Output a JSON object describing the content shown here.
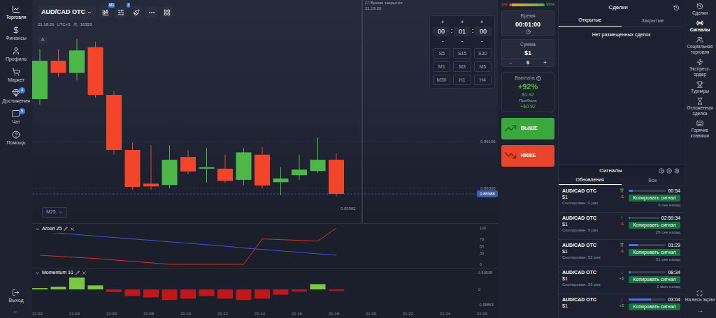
{
  "sidebar": {
    "items": [
      {
        "label": "Торговля",
        "selected": true
      },
      {
        "label": "Финансы",
        "selected": false
      },
      {
        "label": "Профиль",
        "selected": false
      },
      {
        "label": "Маркет",
        "selected": false
      },
      {
        "label": "Достижения",
        "selected": false,
        "badge": "4"
      },
      {
        "label": "Чат",
        "selected": false,
        "badge": "5"
      },
      {
        "label": "Помощь",
        "selected": false
      }
    ],
    "exit": "Выход",
    "collapse": "←"
  },
  "chart": {
    "asset": "AUD/CAD OTC",
    "toolbar_badges": [
      "M1",
      "3"
    ],
    "clock": "21:18:26",
    "timezone": "UTC+5",
    "online": "16328",
    "label_a": "A",
    "timeframe": "M25",
    "close_time": {
      "label": "Время закрытия",
      "value": "21:19:26"
    },
    "price_ticks": [
      {
        "value": 0.861,
        "label": "0.86100"
      },
      {
        "value": 0.86,
        "label": "0.86000"
      }
    ],
    "current_price": {
      "value": 0.85988,
      "label": "0.85988"
    },
    "low_label": "0.85982",
    "candles": [
      {
        "open": 0.86191,
        "close": 0.86273,
        "high": 0.86298,
        "low": 0.86179
      },
      {
        "open": 0.86273,
        "close": 0.86247,
        "high": 0.86298,
        "low": 0.86238
      },
      {
        "open": 0.86247,
        "close": 0.86295,
        "high": 0.8632,
        "low": 0.86231
      },
      {
        "open": 0.86302,
        "close": 0.862,
        "high": 0.86313,
        "low": 0.86194
      },
      {
        "open": 0.862,
        "close": 0.86082,
        "high": 0.86209,
        "low": 0.86072
      },
      {
        "open": 0.86082,
        "close": 0.86003,
        "high": 0.86097,
        "low": 0.85997
      },
      {
        "open": 0.8601,
        "close": 0.86004,
        "high": 0.86092,
        "low": 0.85997
      },
      {
        "open": 0.86007,
        "close": 0.86061,
        "high": 0.86092,
        "low": 0.86
      },
      {
        "open": 0.86067,
        "close": 0.86036,
        "high": 0.86082,
        "low": 0.8603
      },
      {
        "open": 0.86042,
        "close": 0.86045,
        "high": 0.86086,
        "low": 0.86012
      },
      {
        "open": 0.86042,
        "close": 0.86016,
        "high": 0.86072,
        "low": 0.86012
      },
      {
        "open": 0.86018,
        "close": 0.86077,
        "high": 0.86086,
        "low": 0.86007
      },
      {
        "open": 0.86072,
        "close": 0.86006,
        "high": 0.86089,
        "low": 0.86
      },
      {
        "open": 0.86013,
        "close": 0.86021,
        "high": 0.86045,
        "low": 0.85985
      },
      {
        "open": 0.86028,
        "close": 0.8604,
        "high": 0.86072,
        "low": 0.86018
      },
      {
        "open": 0.86037,
        "close": 0.86061,
        "high": 0.86109,
        "low": 0.86033
      },
      {
        "open": 0.86061,
        "close": 0.85988,
        "high": 0.86075,
        "low": 0.85982
      }
    ],
    "x_labels": [
      "21:02",
      "21:04",
      "21:06",
      "21:08",
      "21:10",
      "21:12",
      "21:14",
      "21:16",
      "21:18",
      "21:20",
      "21:22",
      "21:24",
      "21:26"
    ],
    "aroon": {
      "title": "Aroon 25",
      "ticks": [
        "100",
        "70",
        "50",
        "30",
        "0"
      ],
      "up": [
        25,
        22,
        19,
        16,
        12,
        8,
        4,
        0,
        0,
        0,
        0,
        0,
        70,
        68,
        66,
        64,
        100
      ],
      "down": [
        90,
        86,
        82,
        78,
        74,
        70,
        66,
        62,
        58,
        54,
        50,
        45,
        41,
        37,
        33,
        29,
        25
      ]
    },
    "momentum": {
      "title": "Momentum 10",
      "ticks": [
        {
          "value": 0.63538,
          "label": "0.63538"
        },
        {
          "value": 0,
          "label": "0"
        },
        {
          "value": -0.58863,
          "label": "-0.58863"
        }
      ],
      "values": [
        0.05,
        0.1,
        0.45,
        0.15,
        -0.1,
        -0.25,
        -0.3,
        -0.4,
        -0.35,
        -0.25,
        -0.35,
        -0.4,
        -0.35,
        -0.2,
        -0.08,
        0.2,
        -0.05
      ]
    }
  },
  "time_picker": {
    "plus": [
      "+",
      "+",
      "+"
    ],
    "values": [
      "00",
      "01",
      "00"
    ],
    "separator": ":",
    "minus": [
      "-",
      "-",
      "-"
    ],
    "presets": [
      {
        "label": "S5",
        "selected": false
      },
      {
        "label": "S15",
        "selected": false
      },
      {
        "label": "S30",
        "selected": false
      },
      {
        "label": "M1",
        "selected": false
      },
      {
        "label": "M3",
        "selected": false
      },
      {
        "label": "M5",
        "selected": false
      },
      {
        "label": "M30",
        "selected": false
      },
      {
        "label": "H1",
        "selected": false
      },
      {
        "label": "H4",
        "selected": false
      }
    ]
  },
  "trade": {
    "sentiment": {
      "down": "1%",
      "up": "99%",
      "level": 0.99
    },
    "time_label": "Время",
    "time_value": "00:01:00",
    "amount_label": "Сумма",
    "amount_value": "$1",
    "amount_buttons": [
      "-",
      "$",
      "+"
    ],
    "payout_label": "Выплата",
    "payout_help": "?",
    "payout_percent": "+92%",
    "payout_amount": "$1.92",
    "profit_label": "Прибыль",
    "profit_value": "+$0.92",
    "up_button": "ВЫШЕ",
    "down_button": "НИЖЕ"
  },
  "deals": {
    "title": "Сделки",
    "tabs": [
      {
        "label": "Открытые",
        "selected": true
      },
      {
        "label": "Закрытые",
        "selected": false
      }
    ],
    "empty": "Нет размещенных сделок"
  },
  "signals": {
    "title": "Сигналы",
    "tabs": [
      {
        "label": "Обновления",
        "selected": true
      },
      {
        "label": "Все",
        "selected": false
      }
    ],
    "rows": [
      {
        "pair": "AUD/CAD OTC",
        "amount": "$1",
        "arrow": "⇈",
        "direction": "up",
        "result": "-$",
        "result_positive": false,
        "time": "00:54",
        "level": 0.12,
        "button": "Копировать сигнал",
        "copied": "Скопирован: 0 раз",
        "ago": "6 сек назад"
      },
      {
        "pair": "AUD/CAD OTC",
        "amount": "$1",
        "arrow": "↑",
        "direction": "up",
        "result": "-$",
        "result_positive": false,
        "time": "02:59:34",
        "level": 0.05,
        "button": "Копировать сигнал",
        "copied": "Скопирован: 9 раз",
        "ago": "26 сек назад"
      },
      {
        "pair": "AUD/CAD OTC",
        "amount": "$1",
        "arrow": "⇈",
        "direction": "up",
        "result": "-$",
        "result_positive": false,
        "time": "01:29",
        "level": 0.25,
        "button": "Копировать сигнал",
        "copied": "Скопирован: 52 раз",
        "ago": "31 сек назад"
      },
      {
        "pair": "AUD/CAD OTC",
        "amount": "$1",
        "arrow": "↓",
        "direction": "down",
        "result": "+$",
        "result_positive": true,
        "time": "08:34",
        "level": 0.05,
        "button": "Копировать сигнал",
        "copied": "Скопирован: 33 раз",
        "ago": "1 мин назад"
      },
      {
        "pair": "AUD/CAD OTC",
        "amount": "$1",
        "arrow": "↓",
        "direction": "down",
        "result": "+$",
        "result_positive": true,
        "time": "03:04",
        "level": 0.6,
        "button": "Копировать сигнал"
      }
    ]
  },
  "right_sidebar": {
    "items": [
      {
        "label": "Сделки",
        "selected": false
      },
      {
        "label": "Сигналы",
        "selected": true
      },
      {
        "label": "Социальная торговля",
        "selected": false
      },
      {
        "label": "Экспресс-ордер",
        "selected": false
      },
      {
        "label": "Турниры",
        "selected": false
      },
      {
        "label": "Отложенная сделка",
        "selected": false
      },
      {
        "label": "Горячие клавиши",
        "selected": false
      }
    ],
    "fullscreen": "На весь экран",
    "expand": "→"
  }
}
